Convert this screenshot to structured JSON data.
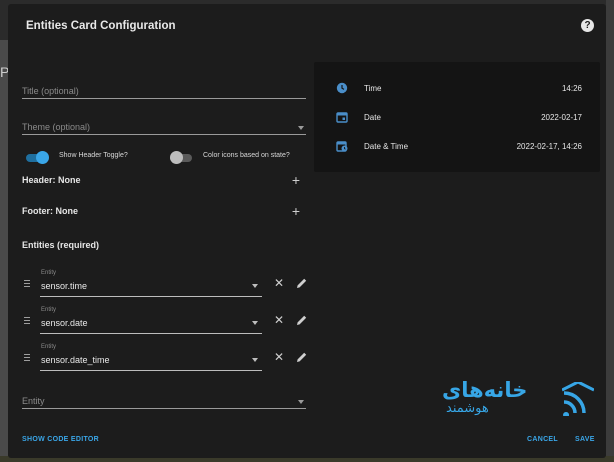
{
  "background": {
    "left_text": "P"
  },
  "dialog": {
    "title": "Entities Card Configuration",
    "help": "?"
  },
  "form": {
    "title_placeholder": "Title (optional)",
    "theme_placeholder": "Theme (optional)",
    "toggle_header_label": "Show Header Toggle?",
    "toggle_header_on": true,
    "toggle_color_label": "Color icons based on state?",
    "toggle_color_on": false,
    "header_label": "Header: None",
    "footer_label": "Footer: None",
    "entities_title": "Entities (required)",
    "entities": [
      {
        "label": "Entity",
        "value": "sensor.time"
      },
      {
        "label": "Entity",
        "value": "sensor.date"
      },
      {
        "label": "Entity",
        "value": "sensor.date_time"
      }
    ],
    "new_entity_placeholder": "Entity"
  },
  "preview": {
    "rows": [
      {
        "icon": "clock-icon",
        "name": "Time",
        "state": "14:26"
      },
      {
        "icon": "calendar-icon",
        "name": "Date",
        "state": "2022-02-17"
      },
      {
        "icon": "calendar-clock-icon",
        "name": "Date & Time",
        "state": "2022-02-17, 14:26"
      }
    ]
  },
  "footer": {
    "code_editor": "SHOW CODE EDITOR",
    "cancel": "CANCEL",
    "save": "SAVE"
  },
  "watermark": {
    "line1": "خانه‌های",
    "line2": "هوشمند"
  },
  "colors": {
    "accent": "#3aa6e8",
    "dialog_bg": "#1c1c1c",
    "preview_bg": "#141414",
    "logo": "#37a6e6"
  }
}
